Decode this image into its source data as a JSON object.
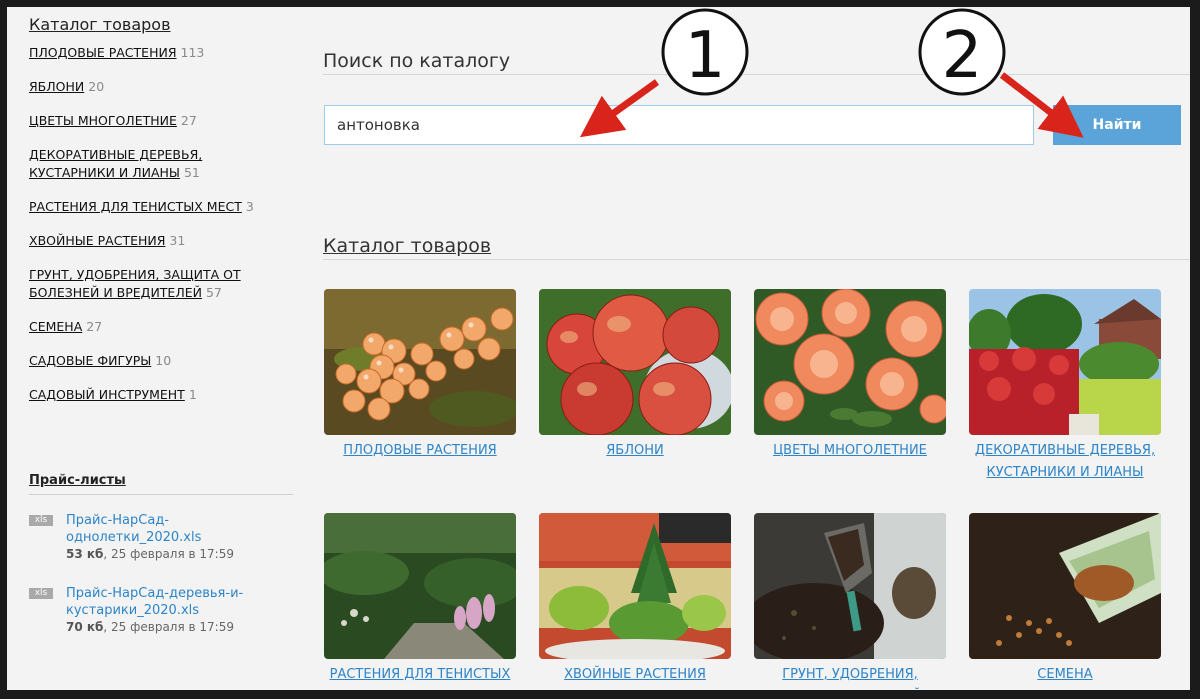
{
  "sidebar": {
    "title": "Каталог товаров",
    "categories": [
      {
        "label": "ПЛОДОВЫЕ РАСТЕНИЯ",
        "count": "113"
      },
      {
        "label": "ЯБЛОНИ",
        "count": "20"
      },
      {
        "label": "ЦВЕТЫ МНОГОЛЕТНИЕ",
        "count": "27"
      },
      {
        "label": "ДЕКОРАТИВНЫЕ ДЕРЕВЬЯ, КУСТАРНИКИ И ЛИАНЫ",
        "count": "51"
      },
      {
        "label": "РАСТЕНИЯ ДЛЯ ТЕНИСТЫХ МЕСТ",
        "count": "3"
      },
      {
        "label": "ХВОЙНЫЕ РАСТЕНИЯ",
        "count": "31"
      },
      {
        "label": "ГРУНТ, УДОБРЕНИЯ, ЗАЩИТА ОТ БОЛЕЗНЕЙ И ВРЕДИТЕЛЕЙ",
        "count": "57"
      },
      {
        "label": "СЕМЕНА",
        "count": "27"
      },
      {
        "label": "САДОВЫЕ ФИГУРЫ",
        "count": "10"
      },
      {
        "label": "САДОВЫЙ ИНСТРУМЕНТ",
        "count": "1"
      }
    ],
    "price_lists": {
      "title": "Прайс-листы",
      "items": [
        {
          "icon": "xls",
          "name": "Прайс-НарСад-однолетки_2020.xls",
          "size": "53 кб",
          "date": ", 25 февраля в 17:59"
        },
        {
          "icon": "xls",
          "name": "Прайс-НарСад-деревья-и-кустарики_2020.xls",
          "size": "70 кб",
          "date": ", 25 февраля в 17:59"
        }
      ]
    }
  },
  "search": {
    "title": "Поиск по каталогу",
    "value": "антоновка",
    "button": "Найти"
  },
  "catalog": {
    "title": "Каталог товаров",
    "cards": [
      {
        "label": "ПЛОДОВЫЕ РАСТЕНИЯ"
      },
      {
        "label": "ЯБЛОНИ"
      },
      {
        "label": "ЦВЕТЫ МНОГОЛЕТНИЕ"
      },
      {
        "label": "ДЕКОРАТИВНЫЕ ДЕРЕВЬЯ, КУСТАРНИКИ И ЛИАНЫ"
      },
      {
        "label": "РАСТЕНИЯ ДЛЯ ТЕНИСТЫХ МЕСТ"
      },
      {
        "label": "ХВОЙНЫЕ РАСТЕНИЯ"
      },
      {
        "label": "ГРУНТ, УДОБРЕНИЯ, ЗАЩИТА ОТ БОЛЕЗНЕЙ И ВРЕДИТЕЛЕЙ"
      },
      {
        "label": "СЕМЕНА"
      }
    ]
  },
  "annotations": {
    "callout_1": "1",
    "callout_2": "2",
    "arrow_color": "#d9241b"
  },
  "colors": {
    "link": "#2d84c8",
    "button": "#5aa4da",
    "input_border": "#9fcbe8"
  }
}
